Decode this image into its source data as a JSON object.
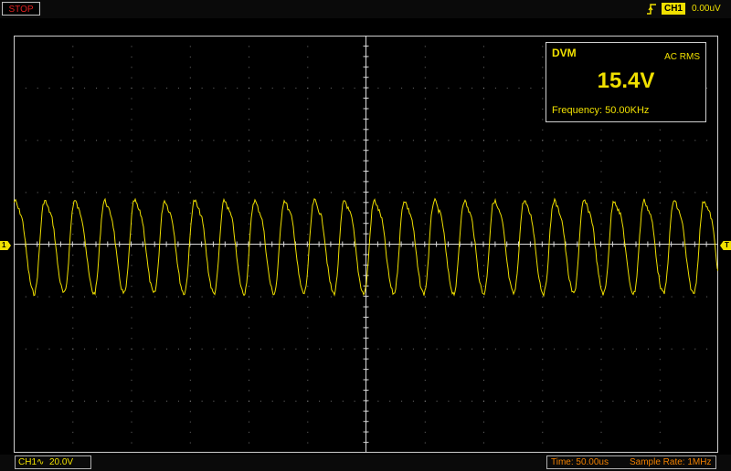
{
  "status": {
    "run_state": "STOP"
  },
  "trigger": {
    "edge_icon": "rising-edge-icon",
    "source": "CH1",
    "level": "0.00uV"
  },
  "dvm": {
    "title": "DVM",
    "mode": "AC RMS",
    "value": "15.4V",
    "frequency": "Frequency: 50.00KHz"
  },
  "markers": {
    "ch1": "1",
    "trigger": "T"
  },
  "channel": {
    "label": "CH1",
    "coupling_symbol": "∿",
    "scale": "20.0V"
  },
  "timebase": {
    "time": "Time: 50.00us",
    "sample_rate": "Sample Rate: 1MHz"
  },
  "colors": {
    "trace": "#f0e000",
    "grid": "#d0d0d0",
    "stop": "#e02020",
    "timebase": "#f08000"
  }
}
